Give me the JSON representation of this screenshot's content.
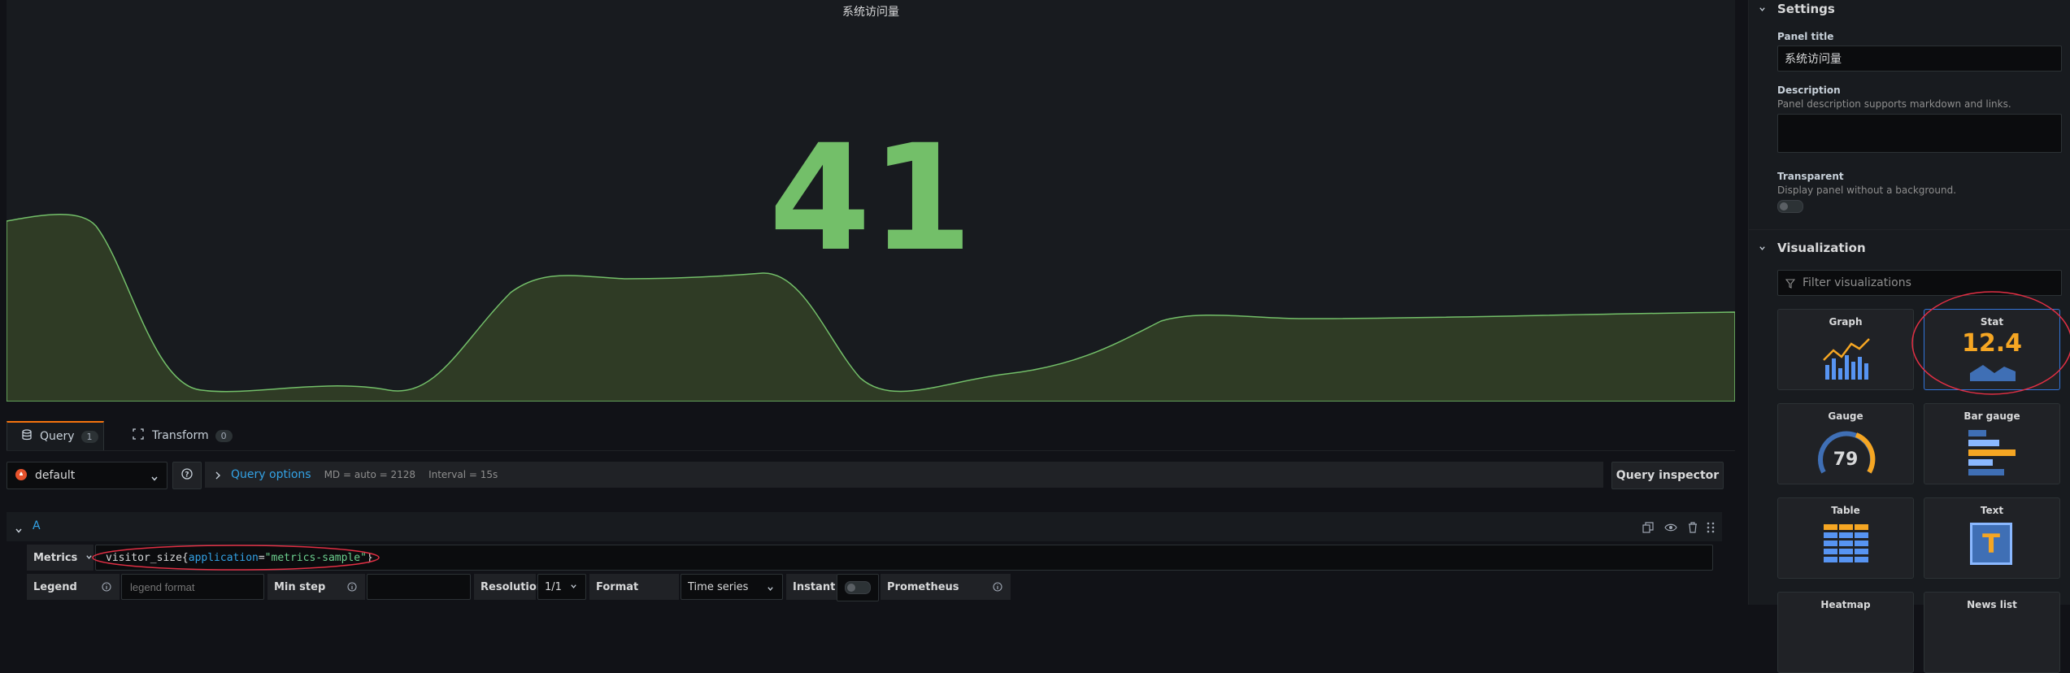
{
  "panel": {
    "title": "系统访问量",
    "stat_value": "41",
    "stat_color": "#73bf69"
  },
  "tabs": [
    {
      "label": "Query",
      "count": "1"
    },
    {
      "label": "Transform",
      "count": "0"
    }
  ],
  "query_row": {
    "datasource": "default",
    "query_options_label": "Query options",
    "query_options_info": "MD = auto = 2128",
    "interval_info": "Interval = 15s",
    "inspector_label": "Query inspector"
  },
  "query_a": {
    "ref": "A",
    "metrics_label": "Metrics",
    "metric_name": "visitor_size",
    "metric_open": "{",
    "label_key": "application",
    "label_eq": "=",
    "label_value": "\"metrics-sample\"",
    "metric_close": "}",
    "legend_label": "Legend",
    "legend_placeholder": "legend format",
    "min_step_label": "Min step",
    "min_step_value": "",
    "resolution_label": "Resolution",
    "resolution_value": "1/1",
    "format_label": "Format",
    "format_value": "Time series",
    "instant_label": "Instant",
    "prometheus_label": "Prometheus"
  },
  "settings": {
    "heading": "Settings",
    "panel_title_label": "Panel title",
    "panel_title_value": "系统访问量",
    "description_label": "Description",
    "description_hint": "Panel description supports markdown and links.",
    "transparent_label": "Transparent",
    "transparent_hint": "Display panel without a background."
  },
  "visualization": {
    "heading": "Visualization",
    "filter_placeholder": "Filter visualizations",
    "cards": [
      {
        "name": "Graph"
      },
      {
        "name": "Stat",
        "sample_value": "12.4"
      },
      {
        "name": "Gauge",
        "sample_value": "79"
      },
      {
        "name": "Bar gauge"
      },
      {
        "name": "Table"
      },
      {
        "name": "Text",
        "glyph": "T"
      },
      {
        "name": "Heatmap"
      },
      {
        "name": "News list"
      }
    ],
    "selected": "Stat"
  },
  "colors": {
    "accent_blue": "#3274d9",
    "stat_green": "#73bf69",
    "orange": "#f5a623",
    "annotation_red": "#e02f44"
  }
}
